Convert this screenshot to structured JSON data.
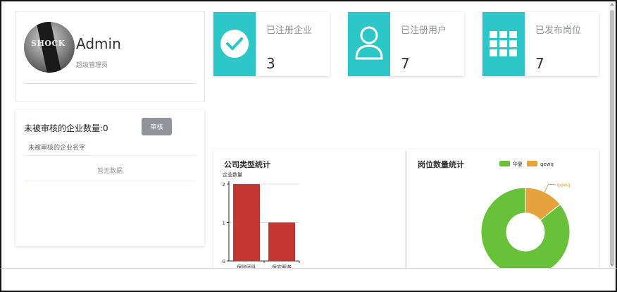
{
  "profile": {
    "name": "Admin",
    "role": "超级管理员",
    "avatar_text": "SHOCK"
  },
  "stats": [
    {
      "label": "已注册企业",
      "value": "3",
      "icon": "check-circle-icon"
    },
    {
      "label": "已注册用户",
      "value": "7",
      "icon": "user-icon"
    },
    {
      "label": "已发布岗位",
      "value": "7",
      "icon": "grid-icon"
    }
  ],
  "pending": {
    "count_text": "未被审核的企业数量:0",
    "audit_button": "审核",
    "column_header": "未被审核的企业名字",
    "empty_text": "暂无数据"
  },
  "colors": {
    "accent": "#2ec7c9",
    "bar": "#c23531",
    "green": "#67c23a",
    "orange": "#e6a23c",
    "button": "#909399"
  },
  "chart_data": [
    {
      "type": "bar",
      "title": "公司类型统计",
      "ylabel": "企业数量",
      "categories": [
        "保险团队",
        "保安服务"
      ],
      "values": [
        2,
        1
      ],
      "ylim": [
        0,
        2
      ],
      "yticks": [
        "0",
        "1",
        "2"
      ],
      "grid": true
    },
    {
      "type": "pie",
      "title": "岗位数量统计",
      "legend": [
        "华夏",
        "qewq"
      ],
      "legend_position": "top-right",
      "labels": [
        "华夏",
        "qewq"
      ],
      "values": [
        6,
        1
      ],
      "donut": true
    }
  ]
}
